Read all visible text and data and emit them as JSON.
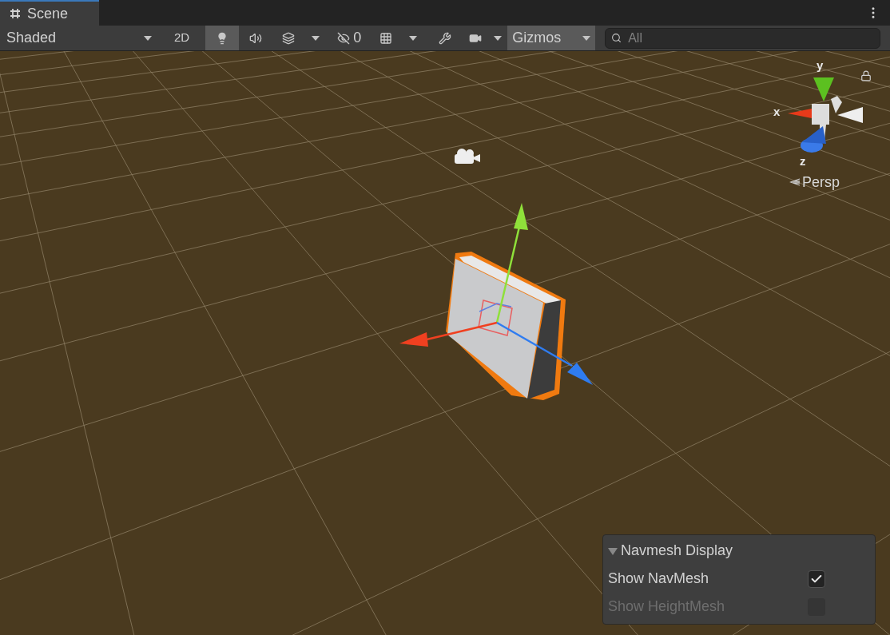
{
  "tab": {
    "label": "Scene",
    "selected": true
  },
  "toolbar": [
    {
      "kind": "dropdown",
      "label": "Shaded"
    },
    {
      "kind": "text",
      "label": "2D",
      "selected": false
    },
    {
      "kind": "lighting",
      "selected": true
    },
    {
      "kind": "audio",
      "selected": false
    },
    {
      "kind": "effects",
      "selected": false
    },
    {
      "kind": "visibility",
      "label": "0",
      "selected": false
    },
    {
      "kind": "grid",
      "selected": false
    },
    {
      "kind": "tools",
      "selected": false
    },
    {
      "kind": "camera",
      "selected": false
    },
    {
      "kind": "gizmos",
      "label": "Gizmos",
      "selected": true
    }
  ],
  "search": {
    "placeholder": "All"
  },
  "orientation_gizmo": {
    "x_label": "x",
    "y_label": "y",
    "z_label": "z",
    "projection": "Persp"
  },
  "navmesh_panel": {
    "title": "Navmesh Display",
    "expanded": true,
    "options": [
      {
        "label": "Show NavMesh",
        "checked": true,
        "disabled": false
      },
      {
        "label": "Show HeightMesh",
        "checked": false,
        "disabled": true
      }
    ]
  }
}
